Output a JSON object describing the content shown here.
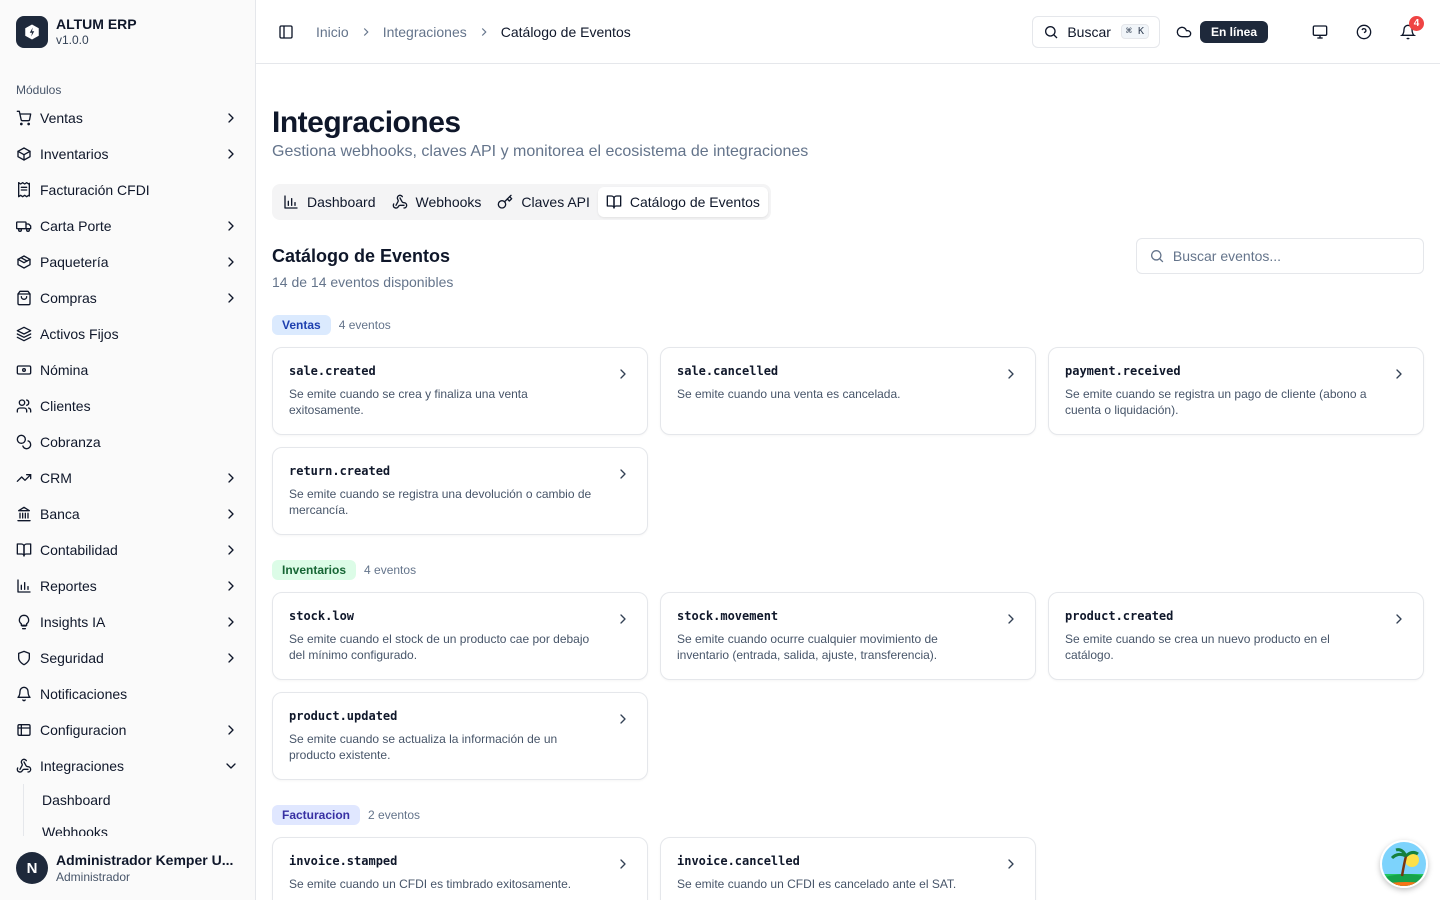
{
  "brand": {
    "name": "ALTUM ERP",
    "version": "v1.0.0"
  },
  "sidebar": {
    "section_label": "Módulos",
    "items": [
      {
        "label": "Ventas",
        "icon": "cart-icon",
        "chevron": true
      },
      {
        "label": "Inventarios",
        "icon": "box-icon",
        "chevron": true
      },
      {
        "label": "Facturación CFDI",
        "icon": "receipt-icon",
        "chevron": false
      },
      {
        "label": "Carta Porte",
        "icon": "truck-icon",
        "chevron": true
      },
      {
        "label": "Paquetería",
        "icon": "package-icon",
        "chevron": true
      },
      {
        "label": "Compras",
        "icon": "shopping-bag-icon",
        "chevron": true
      },
      {
        "label": "Activos Fijos",
        "icon": "layers-icon",
        "chevron": false
      },
      {
        "label": "Nómina",
        "icon": "banknote-icon",
        "chevron": false
      },
      {
        "label": "Clientes",
        "icon": "users-icon",
        "chevron": false
      },
      {
        "label": "Cobranza",
        "icon": "coins-icon",
        "chevron": false
      },
      {
        "label": "CRM",
        "icon": "trending-up-icon",
        "chevron": true
      },
      {
        "label": "Banca",
        "icon": "bank-icon",
        "chevron": true
      },
      {
        "label": "Contabilidad",
        "icon": "book-icon",
        "chevron": true
      },
      {
        "label": "Reportes",
        "icon": "bar-chart-icon",
        "chevron": true
      },
      {
        "label": "Insights IA",
        "icon": "lightbulb-icon",
        "chevron": true
      },
      {
        "label": "Seguridad",
        "icon": "shield-icon",
        "chevron": true
      },
      {
        "label": "Notificaciones",
        "icon": "bell-icon",
        "chevron": false
      },
      {
        "label": "Configuracion",
        "icon": "settings-icon",
        "chevron": true
      },
      {
        "label": "Integraciones",
        "icon": "webhook-icon",
        "chevron": true,
        "expanded": true
      }
    ],
    "sub_items": [
      "Dashboard",
      "Webhooks"
    ]
  },
  "user": {
    "initial": "N",
    "name": "Administrador Kemper U...",
    "role": "Administrador"
  },
  "topbar": {
    "breadcrumb": [
      "Inicio",
      "Integraciones",
      "Catálogo de Eventos"
    ],
    "search_label": "Buscar",
    "search_shortcut": "⌘ K",
    "status": "En línea",
    "notifications_count": "4"
  },
  "page": {
    "title": "Integraciones",
    "subtitle": "Gestiona webhooks, claves API y monitorea el ecosistema de integraciones"
  },
  "tabs": [
    {
      "label": "Dashboard",
      "icon": "bar-chart-icon",
      "active": false
    },
    {
      "label": "Webhooks",
      "icon": "webhook-icon",
      "active": false
    },
    {
      "label": "Claves API",
      "icon": "key-icon",
      "active": false
    },
    {
      "label": "Catálogo de Eventos",
      "icon": "book-open-icon",
      "active": true
    }
  ],
  "catalog": {
    "title": "Catálogo de Eventos",
    "subtitle": "14 de 14 eventos disponibles",
    "search_placeholder": "Buscar eventos..."
  },
  "groups": [
    {
      "name": "Ventas",
      "count": "4 eventos",
      "color_bg": "#dbeafe",
      "color_fg": "#1e40af",
      "events": [
        {
          "name": "sale.created",
          "desc": "Se emite cuando se crea y finaliza una venta exitosamente."
        },
        {
          "name": "sale.cancelled",
          "desc": "Se emite cuando una venta es cancelada."
        },
        {
          "name": "payment.received",
          "desc": "Se emite cuando se registra un pago de cliente (abono a cuenta o liquidación)."
        },
        {
          "name": "return.created",
          "desc": "Se emite cuando se registra una devolución o cambio de mercancía."
        }
      ]
    },
    {
      "name": "Inventarios",
      "count": "4 eventos",
      "color_bg": "#dcfce7",
      "color_fg": "#166534",
      "events": [
        {
          "name": "stock.low",
          "desc": "Se emite cuando el stock de un producto cae por debajo del mínimo configurado."
        },
        {
          "name": "stock.movement",
          "desc": "Se emite cuando ocurre cualquier movimiento de inventario (entrada, salida, ajuste, transferencia)."
        },
        {
          "name": "product.created",
          "desc": "Se emite cuando se crea un nuevo producto en el catálogo."
        },
        {
          "name": "product.updated",
          "desc": "Se emite cuando se actualiza la información de un producto existente."
        }
      ]
    },
    {
      "name": "Facturacion",
      "count": "2 eventos",
      "color_bg": "#e0e7ff",
      "color_fg": "#3730a3",
      "events": [
        {
          "name": "invoice.stamped",
          "desc": "Se emite cuando un CFDI es timbrado exitosamente."
        },
        {
          "name": "invoice.cancelled",
          "desc": "Se emite cuando un CFDI es cancelado ante el SAT."
        }
      ]
    }
  ]
}
